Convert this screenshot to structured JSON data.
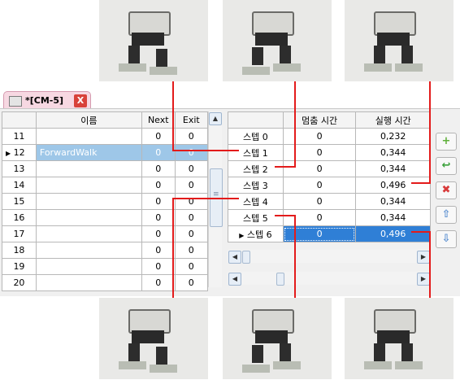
{
  "tab": {
    "title": "*[CM-5]",
    "close_label": "X"
  },
  "left_table": {
    "headers": [
      "",
      "이름",
      "Next",
      "Exit"
    ],
    "rows": [
      {
        "id": "11",
        "name": "",
        "next": "0",
        "exit": "0"
      },
      {
        "id": "12",
        "name": "ForwardWalk",
        "next": "0",
        "exit": "0",
        "selected": true
      },
      {
        "id": "13",
        "name": "",
        "next": "0",
        "exit": "0"
      },
      {
        "id": "14",
        "name": "",
        "next": "0",
        "exit": "0"
      },
      {
        "id": "15",
        "name": "",
        "next": "0",
        "exit": "0"
      },
      {
        "id": "16",
        "name": "",
        "next": "0",
        "exit": "0"
      },
      {
        "id": "17",
        "name": "",
        "next": "0",
        "exit": "0"
      },
      {
        "id": "18",
        "name": "",
        "next": "0",
        "exit": "0"
      },
      {
        "id": "19",
        "name": "",
        "next": "0",
        "exit": "0"
      },
      {
        "id": "20",
        "name": "",
        "next": "0",
        "exit": "0"
      }
    ]
  },
  "right_table": {
    "headers": [
      "",
      "멈춤 시간",
      "실행 시간"
    ],
    "rows": [
      {
        "step": "스텝 0",
        "pause": "0",
        "run": "0,232"
      },
      {
        "step": "스텝 1",
        "pause": "0",
        "run": "0,344"
      },
      {
        "step": "스텝 2",
        "pause": "0",
        "run": "0,344"
      },
      {
        "step": "스텝 3",
        "pause": "0",
        "run": "0,496"
      },
      {
        "step": "스텝 4",
        "pause": "0",
        "run": "0,344"
      },
      {
        "step": "스텝 5",
        "pause": "0",
        "run": "0,344"
      },
      {
        "step": "스텝 6",
        "pause": "0",
        "run": "0,496",
        "selected": true
      }
    ]
  },
  "side_buttons": [
    {
      "name": "add-step-button",
      "glyph": "+",
      "color": "#5fb03a"
    },
    {
      "name": "insert-step-button",
      "glyph": "↩",
      "color": "#3aa03a"
    },
    {
      "name": "delete-step-button",
      "glyph": "✖",
      "color": "#d83a3a"
    },
    {
      "name": "move-up-button",
      "glyph": "⇧",
      "color": "#5b8fd0"
    },
    {
      "name": "move-down-button",
      "glyph": "⇩",
      "color": "#5b8fd0"
    }
  ],
  "icons": {
    "row_pointer": "▶",
    "scroll_up": "▲",
    "scroll_left": "◀",
    "scroll_right": "▶",
    "grip": "≡"
  },
  "colors": {
    "annotation_line": "#e31b1b",
    "selection": "#2f7fd6",
    "selection_light": "#9ec7e8",
    "tab_bg": "#f7d8e2"
  }
}
